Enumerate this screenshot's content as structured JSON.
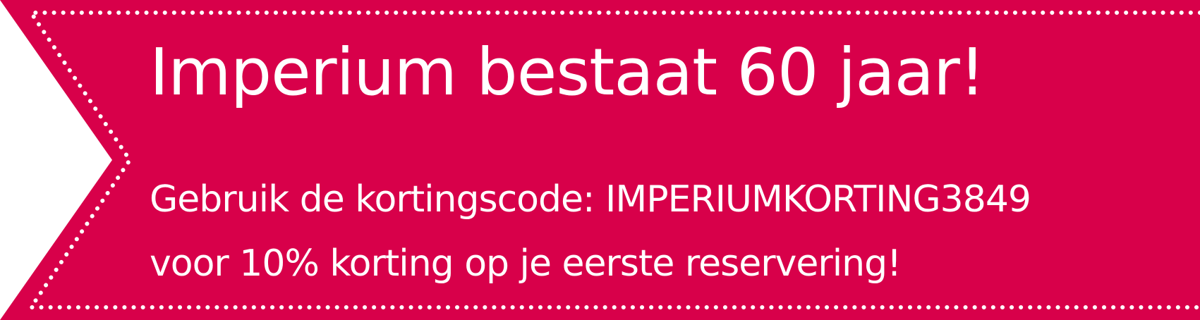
{
  "banner": {
    "background_color": "#d8004a",
    "stitch_color": "#ffffff",
    "headline": "Imperium bestaat 60 jaar!",
    "line1": "Gebruik de kortingscode: IMPERIUMKORTING3849",
    "line2": "voor 10% korting op je eerste reservering!"
  }
}
